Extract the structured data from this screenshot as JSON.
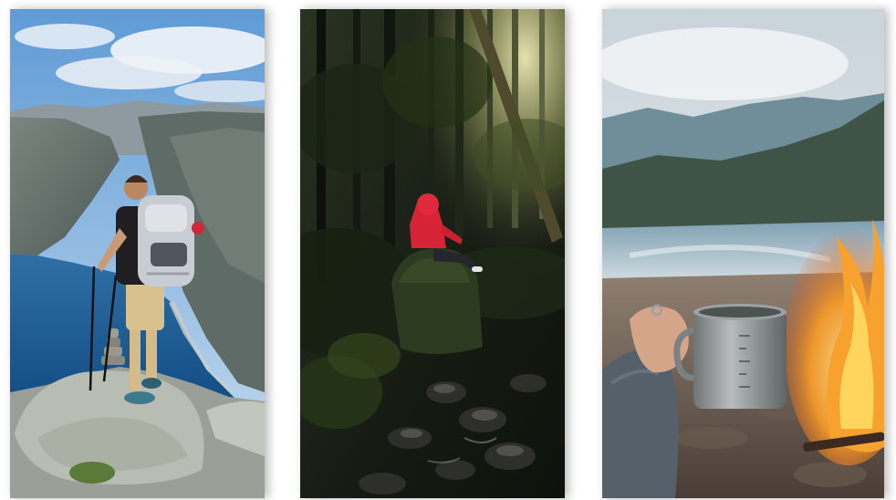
{
  "gallery": {
    "images": [
      {
        "subject": "hiker-on-mountain-overlooking-fjord",
        "palette": {
          "sky": "#7fb0de",
          "water": "#1f5f96",
          "rock": "#8f9894"
        }
      },
      {
        "subject": "person-in-red-jacket-in-dark-forest",
        "palette": {
          "forest": "#1c2417",
          "jacket": "#d62436",
          "light": "#d8d49a"
        }
      },
      {
        "subject": "hand-holding-metal-mug-by-campfire-at-lake",
        "palette": {
          "sky": "#dfe6ea",
          "lake": "#a9bfc9",
          "fire": "#f49a2a",
          "mug": "#8b9090"
        }
      }
    ]
  }
}
